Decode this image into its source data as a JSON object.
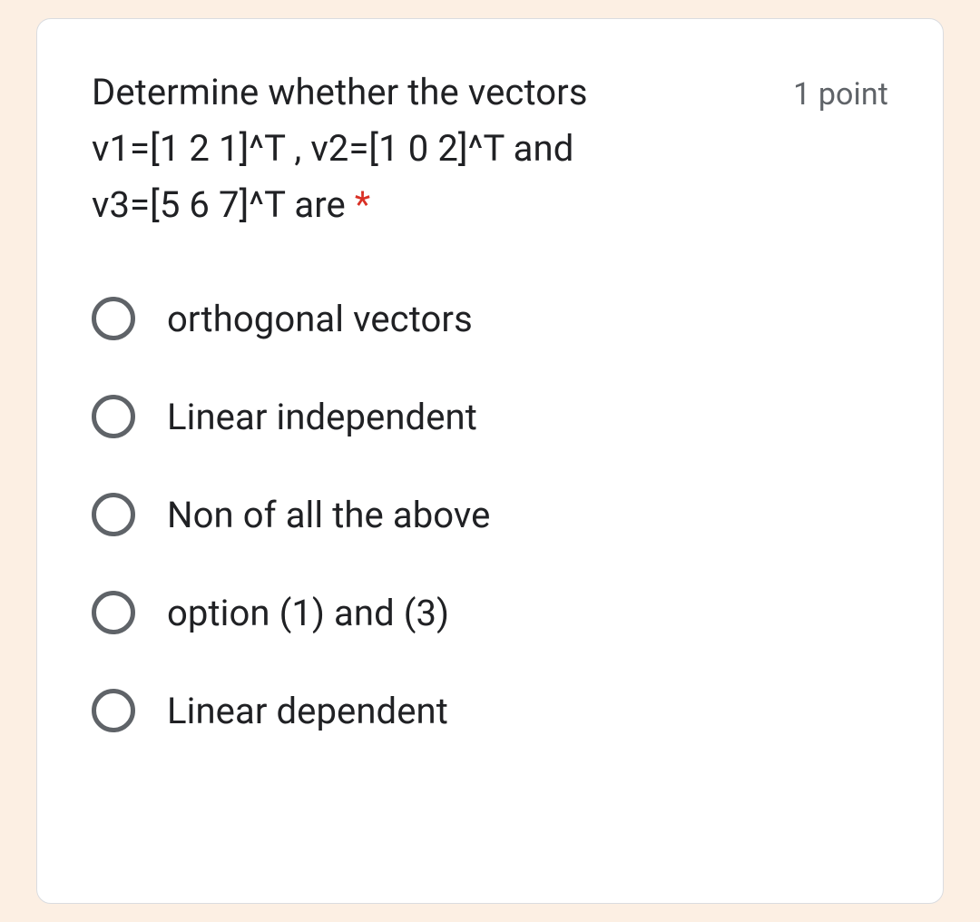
{
  "question": {
    "line1": "Determine whether the vectors",
    "line2": "v1=[1 2 1]^T , v2=[1 0 2]^T and",
    "line3": "v3=[5 6 7]^T are",
    "required_mark": "*",
    "points": "1 point"
  },
  "options": [
    {
      "label": "orthogonal vectors"
    },
    {
      "label": "Linear independent"
    },
    {
      "label": "Non of all the above"
    },
    {
      "label": "option (1) and (3)"
    },
    {
      "label": "Linear dependent"
    }
  ]
}
